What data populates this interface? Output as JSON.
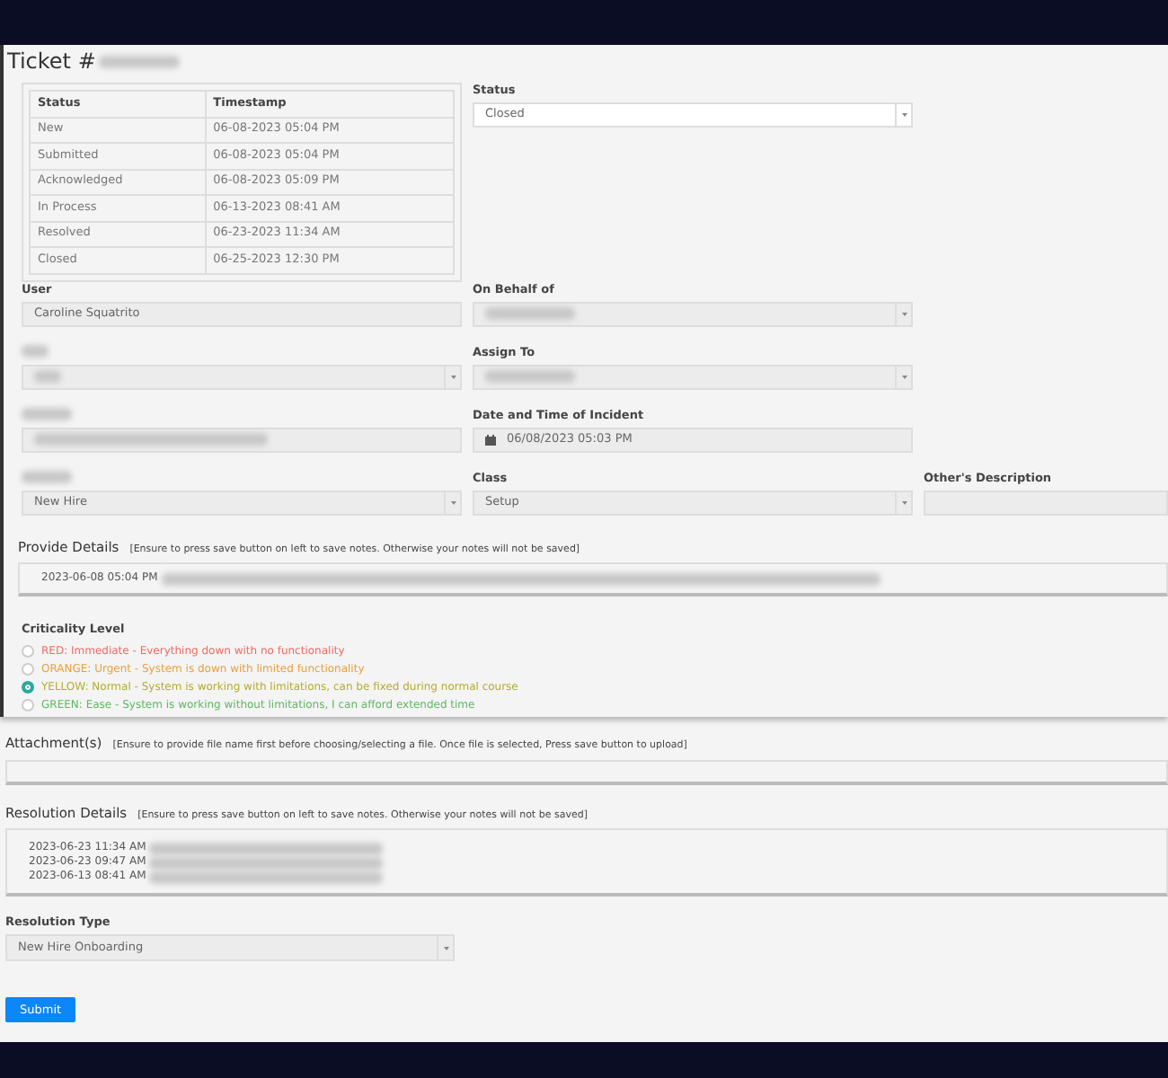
{
  "title": "Ticket #",
  "title_blurred": true,
  "history": {
    "columns": [
      "Status",
      "Timestamp"
    ],
    "rows": [
      [
        "New",
        "06-08-2023 05:04 PM"
      ],
      [
        "Submitted",
        "06-08-2023 05:04 PM"
      ],
      [
        "Acknowledged",
        "06-08-2023 05:09 PM"
      ],
      [
        "In Process",
        "06-13-2023 08:41 AM"
      ],
      [
        "Resolved",
        "06-23-2023 11:34 AM"
      ],
      [
        "Closed",
        "06-25-2023 12:30 PM"
      ]
    ]
  },
  "status": {
    "label": "Status",
    "value": "Closed"
  },
  "field_rows": [
    [
      {
        "label": "User",
        "kind": "text",
        "value": "Caroline Squatrito"
      },
      {
        "label": "On Behalf of",
        "kind": "select",
        "value_blurred": true
      }
    ],
    [
      {
        "label_blurred": true,
        "kind": "select",
        "value_blurred": true
      },
      {
        "label": "Assign To",
        "kind": "select",
        "value_blurred": true
      }
    ],
    [
      {
        "label_blurred": true,
        "kind": "text",
        "value_blurred": true
      },
      {
        "label": "Date and Time of Incident",
        "kind": "date",
        "value": "06/08/2023 05:03 PM"
      }
    ],
    [
      {
        "label_blurred": true,
        "kind": "select",
        "value": "New Hire"
      },
      {
        "label": "Class",
        "kind": "select",
        "value": "Setup"
      },
      {
        "label": "Other's Description",
        "kind": "text"
      }
    ]
  ],
  "details": {
    "label": "Provide Details",
    "note": "[Ensure to press save button on left to save notes. Otherwise your notes will not be saved]",
    "lines": [
      {
        "time": "2023-06-08 05:04 PM",
        "blurred": true
      }
    ]
  },
  "criticality": {
    "label": "Criticality Level",
    "options": [
      {
        "label": "RED: Immediate - Everything down with no functionality",
        "color": "#ee6b64",
        "selected": false
      },
      {
        "label": "ORANGE: Urgent - System is down with limited functionality",
        "color": "#e9a03c",
        "selected": false
      },
      {
        "label": "YELLOW: Normal - System is working with limitations, can be fixed during normal course",
        "color": "#b3ad2c",
        "selected": true
      },
      {
        "label": "GREEN: Ease - System is working without limitations, I can afford extended time",
        "color": "#5db761",
        "selected": false
      }
    ]
  },
  "attachments": {
    "label": "Attachment(s)",
    "note": "[Ensure to provide file name first before choosing/selecting a file. Once file is selected, Press save button to upload]"
  },
  "resolution": {
    "label": "Resolution Details",
    "note": "[Ensure to press save button on left to save notes. Otherwise your notes will not be saved]",
    "lines": [
      {
        "time": "2023-06-23 11:34 AM",
        "blurred": true
      },
      {
        "time": "2023-06-23 09:47 AM",
        "blurred": true
      },
      {
        "time": "2023-06-13 08:41 AM",
        "blurred": true
      }
    ]
  },
  "resolution_type": {
    "label": "Resolution Type",
    "value": "New Hire Onboarding"
  },
  "submit": "Submit"
}
